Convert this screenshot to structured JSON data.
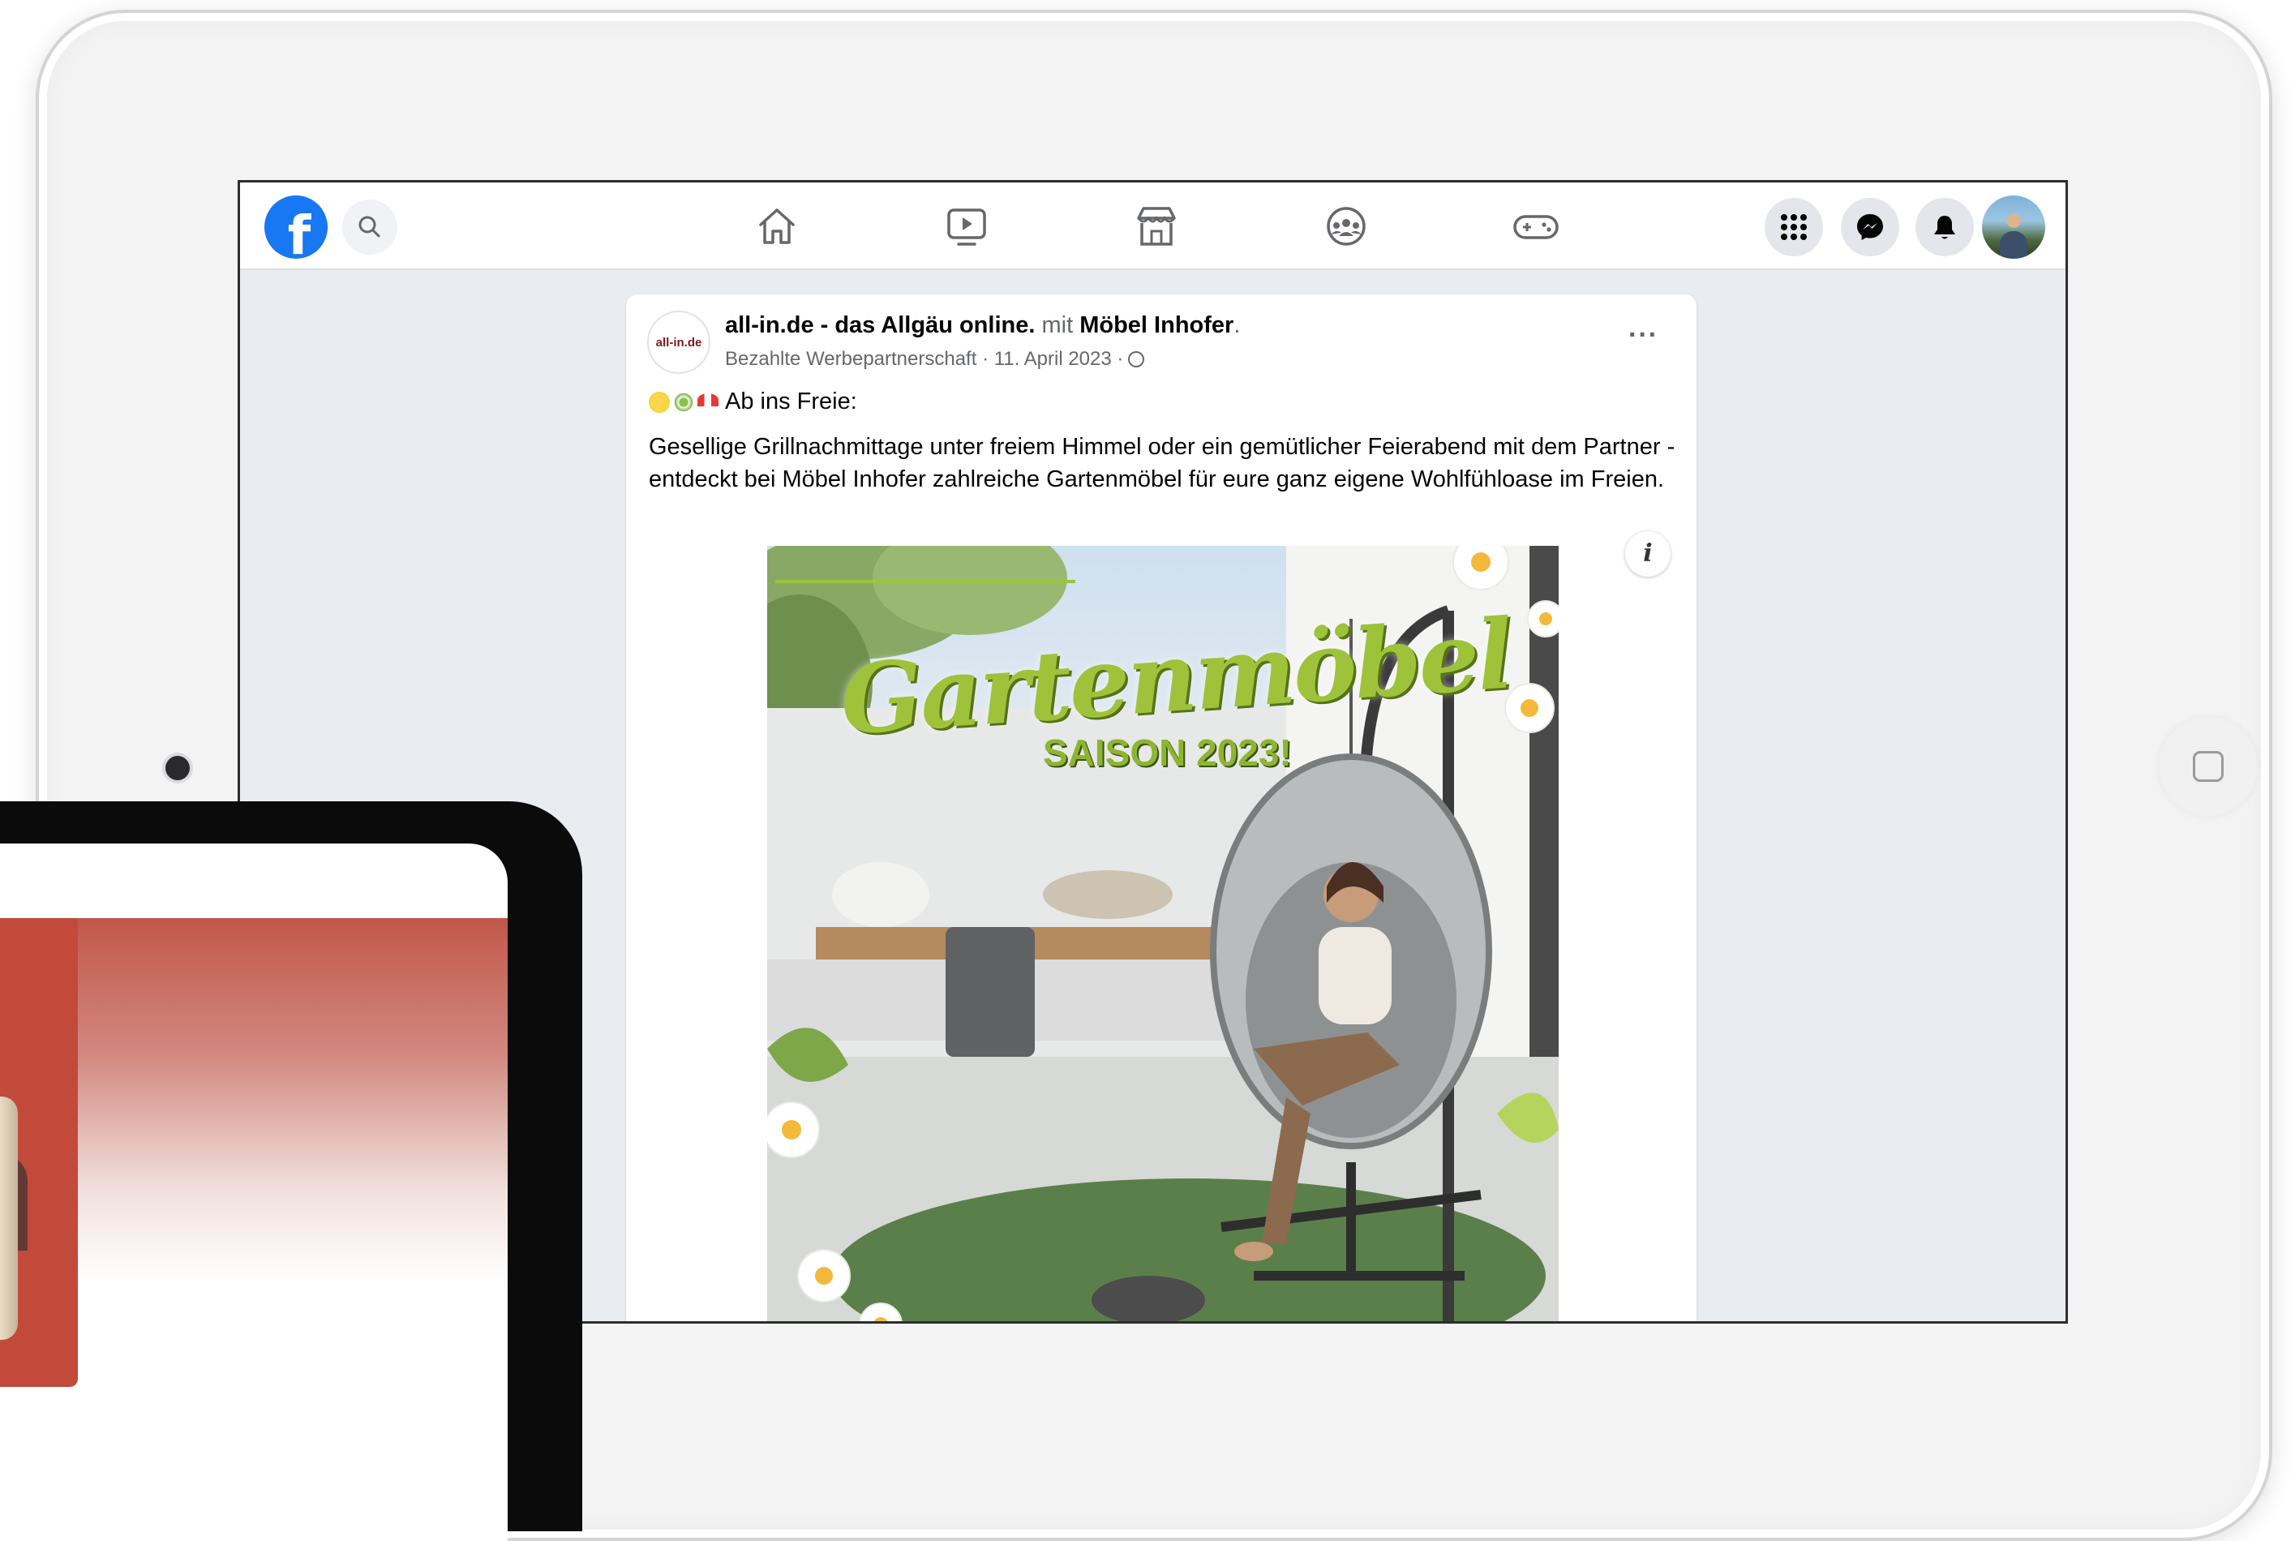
{
  "nav": {
    "logo_letter": "f",
    "icons": [
      "search-icon",
      "home-icon",
      "watch-icon",
      "marketplace-icon",
      "groups-icon",
      "gaming-icon",
      "menu-grid-icon",
      "messenger-icon",
      "notifications-icon",
      "profile-avatar"
    ]
  },
  "post": {
    "page_avatar_text": "all-in.de",
    "author": "all-in.de - das Allgäu online.",
    "with_word": "mit",
    "partner": "Möbel Inhofer",
    "title_period": ".",
    "meta": "Bezahlte Werbepartnerschaft · 11. April 2023 ·",
    "more": "···",
    "emoji_line": "Ab ins Freie:",
    "body": "Gesellige Grillnachmittage unter freiem Himmel oder ein gemütlicher Feierabend mit dem Partner - entdeckt bei Möbel Inhofer zahlreiche Gartenmöbel für eure ganz eigene Wohlfühloase im Freien.",
    "info": "i"
  },
  "ad": {
    "title": "Gartenmöbel",
    "subtitle": "SAISON 2023!"
  },
  "colors": {
    "facebook_blue": "#1877f2",
    "feed_background": "#e9ecf1",
    "ad_green": "#9ec33b"
  }
}
